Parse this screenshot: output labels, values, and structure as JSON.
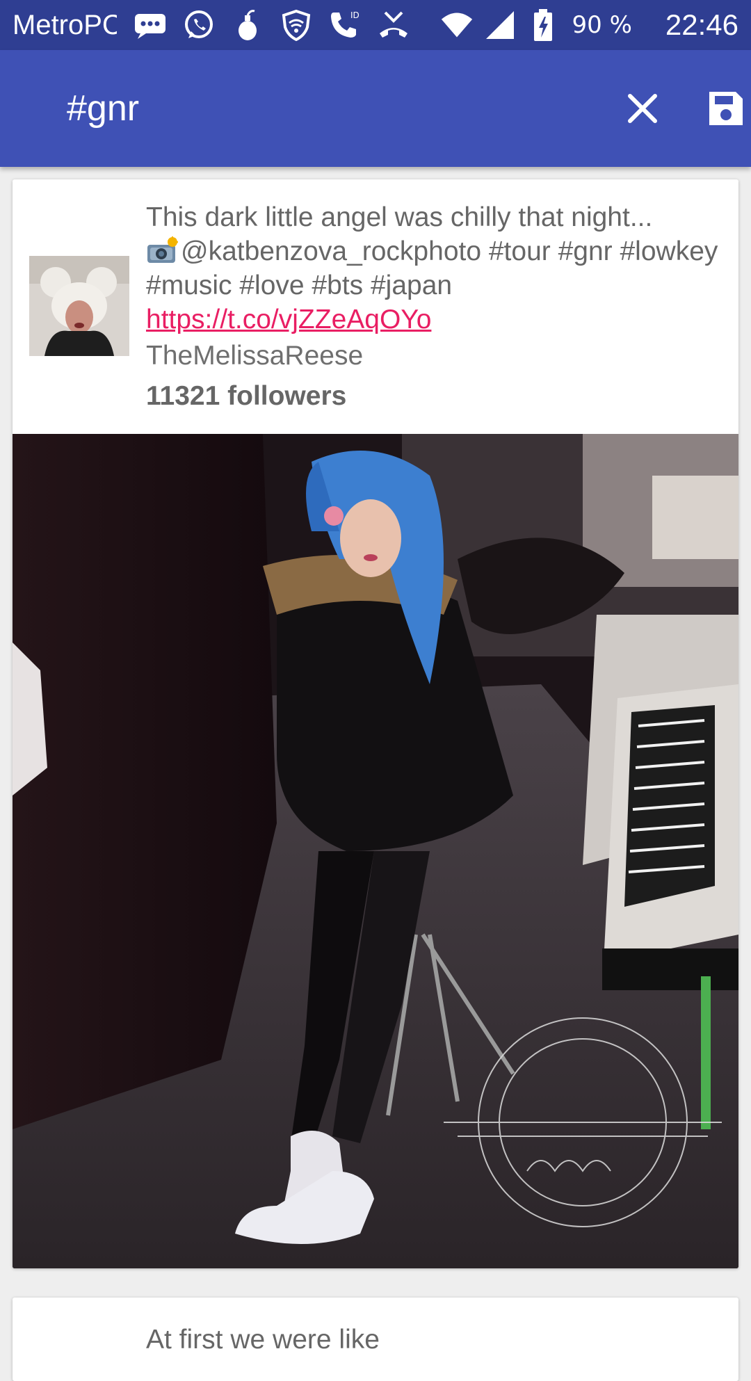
{
  "status_bar": {
    "carrier": "MetroPCS",
    "battery": "90 %",
    "time": "22:46",
    "icons": [
      "messages-icon",
      "whatsapp-icon",
      "bomb-icon",
      "vpn-shield-icon",
      "wifi-calling-icon",
      "missed-call-icon",
      "wifi-icon",
      "signal-icon",
      "battery-charging-icon"
    ]
  },
  "app_bar": {
    "query": "#gnr",
    "close_icon": "close-icon",
    "save_icon": "save-icon",
    "color": "#3f51b5"
  },
  "tweets": [
    {
      "text_before": "This dark little angel was chilly that night...",
      "text_main": "@katbenzova_rockphoto #tour #gnr #lowkey #music #love #bts #japan ",
      "link": "https://t.co/vjZZeAqOYo",
      "username": "TheMelissaReese",
      "followers": "11321 followers",
      "link_color": "#e91e63"
    },
    {
      "text_before": "At first we were like"
    }
  ]
}
